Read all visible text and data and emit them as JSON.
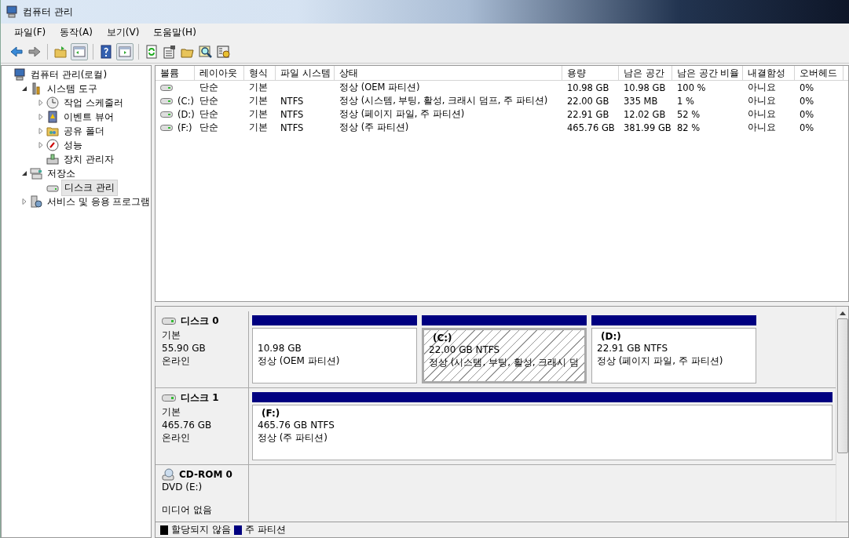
{
  "window": {
    "title": "컴퓨터 관리"
  },
  "menu": [
    "파일(F)",
    "동작(A)",
    "보기(V)",
    "도움말(H)"
  ],
  "tree": [
    {
      "label": "컴퓨터 관리(로컬)",
      "kind": "computer",
      "selected": false,
      "children": [
        {
          "label": "시스템 도구",
          "kind": "tools",
          "selected": false,
          "expanded": true,
          "children": [
            {
              "label": "작업 스케줄러",
              "kind": "clock",
              "selected": false,
              "expanded": false
            },
            {
              "label": "이벤트 뷰어",
              "kind": "event",
              "selected": false,
              "expanded": false
            },
            {
              "label": "공유 폴더",
              "kind": "folder",
              "selected": false,
              "expanded": false
            },
            {
              "label": "성능",
              "kind": "gauge",
              "selected": false,
              "expanded": false
            },
            {
              "label": "장치 관리자",
              "kind": "device",
              "selected": false
            }
          ]
        },
        {
          "label": "저장소",
          "kind": "storage",
          "selected": false,
          "expanded": true,
          "children": [
            {
              "label": "디스크 관리",
              "kind": "disk",
              "selected": true
            }
          ]
        },
        {
          "label": "서비스 및 응용 프로그램",
          "kind": "services",
          "selected": false,
          "expanded": false
        }
      ]
    }
  ],
  "table": {
    "columns": [
      "볼륨",
      "레이아웃",
      "형식",
      "파일 시스템",
      "상태",
      "용량",
      "남은 공간",
      "남은 공간 비율",
      "내결함성",
      "오버헤드"
    ],
    "rows": [
      [
        "",
        "단순",
        "기본",
        "",
        "정상 (OEM 파티션)",
        "10.98 GB",
        "10.98 GB",
        "100 %",
        "아니요",
        "0%"
      ],
      [
        "(C:)",
        "단순",
        "기본",
        "NTFS",
        "정상 (시스템, 부팅, 활성, 크래시 덤프, 주 파티션)",
        "22.00 GB",
        "335 MB",
        "1 %",
        "아니요",
        "0%"
      ],
      [
        "(D:)",
        "단순",
        "기본",
        "NTFS",
        "정상 (페이지 파일, 주 파티션)",
        "22.91 GB",
        "12.02 GB",
        "52 %",
        "아니요",
        "0%"
      ],
      [
        "(F:)",
        "단순",
        "기본",
        "NTFS",
        "정상 (주 파티션)",
        "465.76 GB",
        "381.99 GB",
        "82 %",
        "아니요",
        "0%"
      ]
    ]
  },
  "disks": [
    {
      "kind": "disk",
      "name": "디스크 0",
      "type": "기본",
      "size": "55.90 GB",
      "state": "온라인",
      "partitions": [
        {
          "size": "10.98 GB",
          "status": "정상 (OEM 파티션)",
          "selected": false
        },
        {
          "label": "(C:)",
          "size": "22.00 GB NTFS",
          "status": "정상 (시스템, 부팅, 활성, 크래시 덤",
          "selected": true
        },
        {
          "label": "(D:)",
          "size": "22.91 GB NTFS",
          "status": "정상 (페이지 파일, 주 파티션)",
          "selected": false
        }
      ]
    },
    {
      "kind": "disk",
      "name": "디스크 1",
      "type": "기본",
      "size": "465.76 GB",
      "state": "온라인",
      "partitions": [
        {
          "label": "(F:)",
          "size": "465.76 GB NTFS",
          "status": "정상 (주 파티션)",
          "selected": false
        }
      ]
    },
    {
      "kind": "cdrom",
      "name": "CD-ROM 0",
      "type": "DVD (E:)",
      "state": "미디어 없음"
    }
  ],
  "legend": [
    {
      "label": "할당되지 않음",
      "color": "#000000"
    },
    {
      "label": "주 파티션",
      "color": "#000080"
    }
  ]
}
